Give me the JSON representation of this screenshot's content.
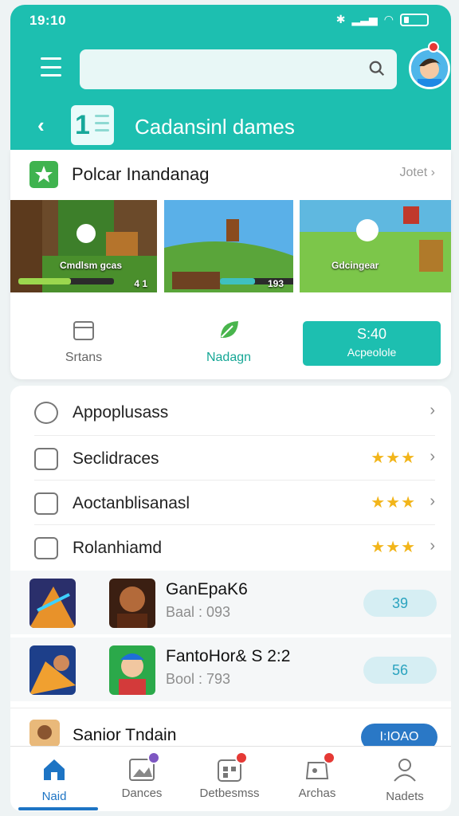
{
  "status": {
    "time": "19:10"
  },
  "header": {
    "title": "Cadansinl dames",
    "logo_text": "1",
    "search_placeholder": ""
  },
  "featured": {
    "title": "Polcar Inandanag",
    "see_all": "Jotet",
    "screens": [
      {
        "label": "Cmdlsm gcas",
        "badge": "4 1"
      },
      {
        "label": "",
        "badge": "193"
      },
      {
        "label": "Gdcingear",
        "badge": ""
      }
    ],
    "tabs": [
      {
        "label": "Srtans",
        "icon": "calendar-icon"
      },
      {
        "label": "Nadagn",
        "icon": "leaf-icon"
      }
    ],
    "cta": {
      "top": "S:40",
      "bottom": "Acpeolole"
    }
  },
  "list": {
    "items": [
      {
        "label": "Appoplusass",
        "stars": "",
        "icon": "chat-icon"
      },
      {
        "label": "Seclidraces",
        "stars": "★★★",
        "icon": "folder-icon"
      },
      {
        "label": "Aoctanblisanasl",
        "stars": "★★★",
        "icon": "coin-icon"
      },
      {
        "label": "Rolanhiamd",
        "stars": "★★★",
        "icon": "badge-icon"
      }
    ]
  },
  "games": [
    {
      "title": "GanEpaK6",
      "subtitle": "Baal : 093",
      "price": "39"
    },
    {
      "title": "FantoHor& S 2:2",
      "subtitle": "Bool : 793",
      "price": "56"
    }
  ],
  "game3": {
    "title": "Sanior Tndain",
    "button": "I:IOAO"
  },
  "nav": {
    "items": [
      {
        "label": "Naid",
        "icon": "home-icon"
      },
      {
        "label": "Dances",
        "icon": "image-icon"
      },
      {
        "label": "Detbesmss",
        "icon": "calendar-icon"
      },
      {
        "label": "Archas",
        "icon": "game-icon"
      },
      {
        "label": "Nadets",
        "icon": "person-icon"
      }
    ]
  },
  "colors": {
    "accent": "#1dbfb0",
    "nav_active": "#1d74c4",
    "star": "#f2b51a",
    "badge": "#e53935"
  }
}
